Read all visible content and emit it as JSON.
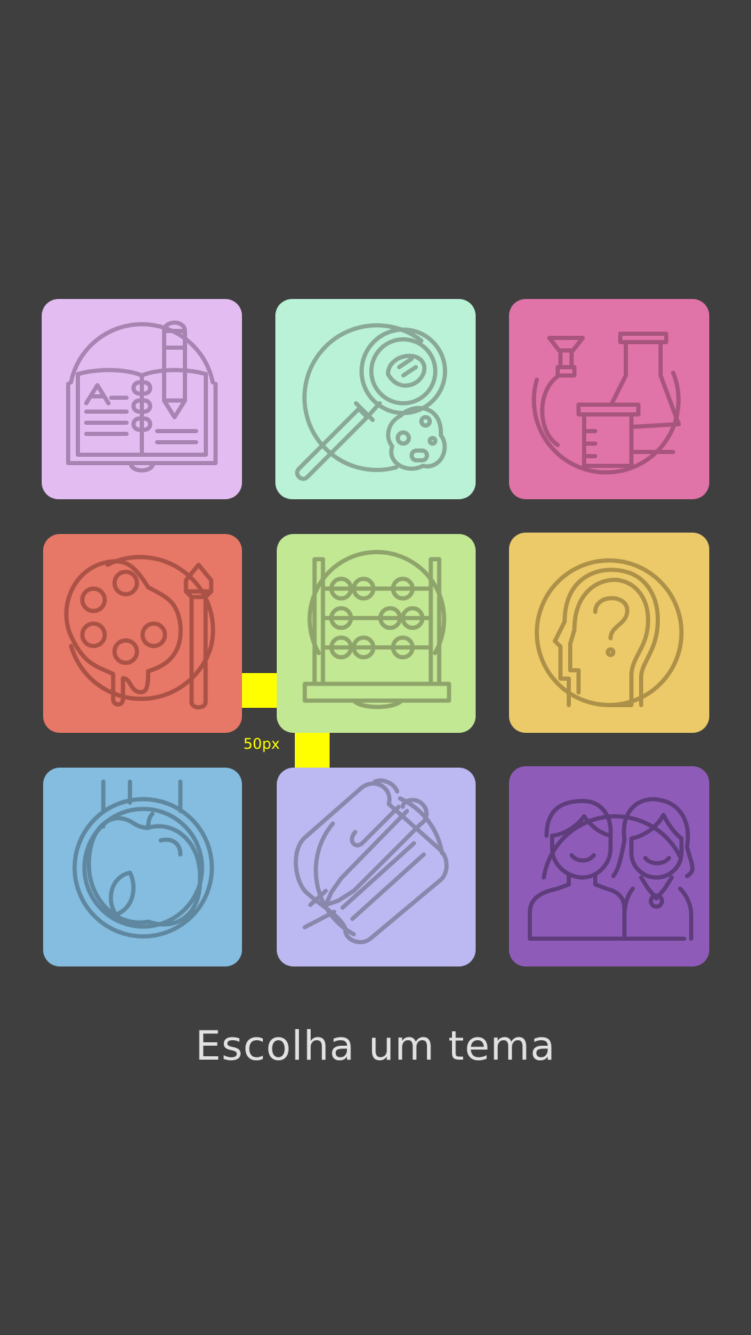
{
  "title": "Escolha um tema",
  "spacer_label": "50px",
  "colors": {
    "background": "#3f3f3f",
    "spacer": "#ffff00",
    "title": "#e2e2e2"
  },
  "tiles": [
    {
      "icon": "book-pencil-icon",
      "bg": "#e3bdf1",
      "stroke": "#a784b2"
    },
    {
      "icon": "magnifier-microbe-icon",
      "bg": "#b9f2d7",
      "stroke": "#8aa897"
    },
    {
      "icon": "lab-flasks-icon",
      "bg": "#e073a8",
      "stroke": "#a8557e"
    },
    {
      "icon": "paint-palette-icon",
      "bg": "#e77766",
      "stroke": "#ab5246"
    },
    {
      "icon": "abacus-icon",
      "bg": "#c2e894",
      "stroke": "#8fa46a"
    },
    {
      "icon": "head-question-icon",
      "bg": "#ecca6a",
      "stroke": "#ad9148"
    },
    {
      "icon": "apple-icon",
      "bg": "#84bddf",
      "stroke": "#5f88a0"
    },
    {
      "icon": "pen-scroll-icon",
      "bg": "#bcb9f2",
      "stroke": "#8a87ad"
    },
    {
      "icon": "people-icon",
      "bg": "#8e5cb8",
      "stroke": "#5f3d7d"
    }
  ]
}
